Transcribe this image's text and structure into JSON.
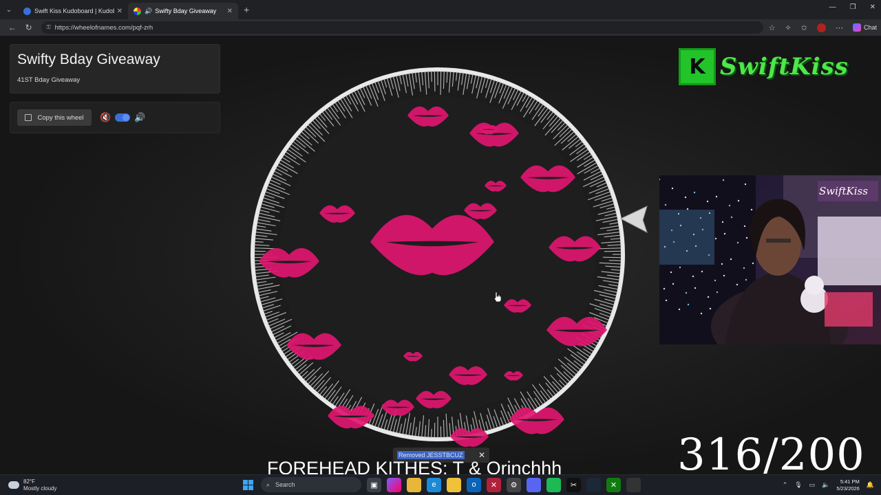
{
  "browser": {
    "tabs": [
      {
        "label": "Swift Kiss Kudoboard | Kudoboard",
        "active": false
      },
      {
        "label": "Swifty Bday Giveaway",
        "active": true
      }
    ],
    "url": "https://wheelofnames.com/pqf-zrh",
    "chat_label": "Chat"
  },
  "wheel_page": {
    "title": "Swifty Bday Giveaway",
    "description": "41ST Bday Giveaway",
    "copy_button_label": "Copy this wheel",
    "sound_enabled": true
  },
  "toast": {
    "text": "Removed JESSTBCUZ"
  },
  "overlay": {
    "logo_text": "SwiftKiss",
    "logo_letter": "K",
    "counter": "316/200",
    "caption": "FOREHEAD KITHES: T & Orinchhh",
    "webcam_sign": "SwiftKiss"
  },
  "taskbar": {
    "weather_temp": "82°F",
    "weather_desc": "Mostly cloudy",
    "search_placeholder": "Search",
    "time": "5:41 PM",
    "date": "5/23/2026"
  },
  "colors": {
    "accent_pink": "#e0166f",
    "logo_green": "#22c42a",
    "toggle_blue": "#3b6fd8"
  }
}
